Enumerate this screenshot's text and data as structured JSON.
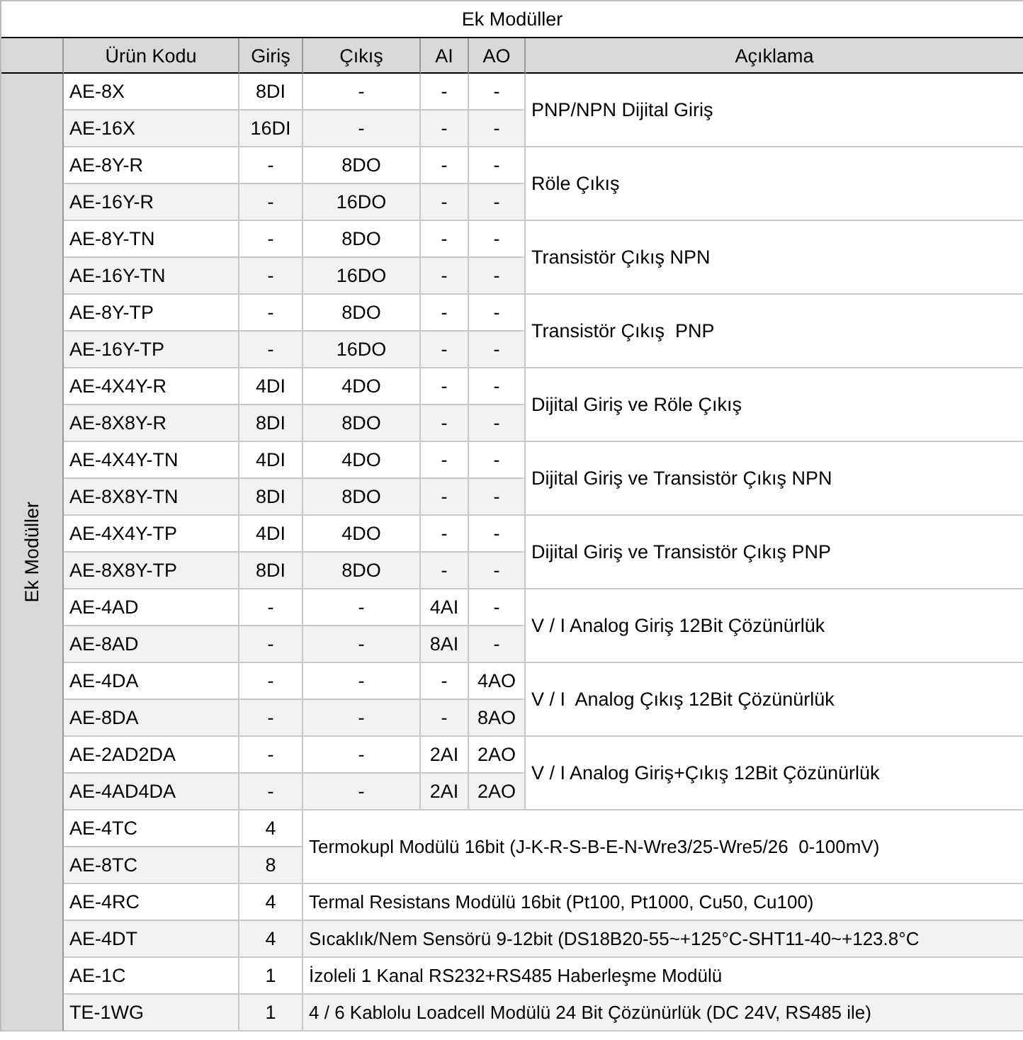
{
  "title": "Ek Modüller",
  "side_label": "Ek Modüller",
  "columns": [
    "Ürün Kodu",
    "Giriş",
    "Çıkış",
    "AI",
    "AO",
    "Açıklama"
  ],
  "groups": [
    {
      "kind": "full",
      "description": "PNP/NPN Dijital Giriş",
      "rows": [
        {
          "code": "AE-8X",
          "input": "8DI",
          "output": "-",
          "ai": "-",
          "ao": "-"
        },
        {
          "code": "AE-16X",
          "input": "16DI",
          "output": "-",
          "ai": "-",
          "ao": "-"
        }
      ]
    },
    {
      "kind": "full",
      "description": "Röle Çıkış",
      "rows": [
        {
          "code": "AE-8Y-R",
          "input": "-",
          "output": "8DO",
          "ai": "-",
          "ao": "-"
        },
        {
          "code": "AE-16Y-R",
          "input": "-",
          "output": "16DO",
          "ai": "-",
          "ao": "-"
        }
      ]
    },
    {
      "kind": "full",
      "description": "Transistör Çıkış NPN",
      "rows": [
        {
          "code": "AE-8Y-TN",
          "input": "-",
          "output": "8DO",
          "ai": "-",
          "ao": "-"
        },
        {
          "code": "AE-16Y-TN",
          "input": "-",
          "output": "16DO",
          "ai": "-",
          "ao": "-"
        }
      ]
    },
    {
      "kind": "full",
      "description": "Transistör Çıkış  PNP",
      "rows": [
        {
          "code": "AE-8Y-TP",
          "input": "-",
          "output": "8DO",
          "ai": "-",
          "ao": "-"
        },
        {
          "code": "AE-16Y-TP",
          "input": "-",
          "output": "16DO",
          "ai": "-",
          "ao": "-"
        }
      ]
    },
    {
      "kind": "full",
      "description": "Dijital Giriş ve Röle Çıkış",
      "rows": [
        {
          "code": "AE-4X4Y-R",
          "input": "4DI",
          "output": "4DO",
          "ai": "-",
          "ao": "-"
        },
        {
          "code": "AE-8X8Y-R",
          "input": "8DI",
          "output": "8DO",
          "ai": "-",
          "ao": "-"
        }
      ]
    },
    {
      "kind": "full",
      "description": "Dijital Giriş ve Transistör Çıkış NPN",
      "rows": [
        {
          "code": "AE-4X4Y-TN",
          "input": "4DI",
          "output": "4DO",
          "ai": "-",
          "ao": "-"
        },
        {
          "code": "AE-8X8Y-TN",
          "input": "8DI",
          "output": "8DO",
          "ai": "-",
          "ao": "-"
        }
      ]
    },
    {
      "kind": "full",
      "description": "Dijital Giriş ve Transistör Çıkış PNP",
      "rows": [
        {
          "code": "AE-4X4Y-TP",
          "input": "4DI",
          "output": "4DO",
          "ai": "-",
          "ao": "-"
        },
        {
          "code": "AE-8X8Y-TP",
          "input": "8DI",
          "output": "8DO",
          "ai": "-",
          "ao": "-"
        }
      ]
    },
    {
      "kind": "full",
      "description": "V / I Analog Giriş 12Bit Çözünürlük",
      "rows": [
        {
          "code": "AE-4AD",
          "input": "-",
          "output": "-",
          "ai": "4AI",
          "ao": "-"
        },
        {
          "code": "AE-8AD",
          "input": "-",
          "output": "-",
          "ai": "8AI",
          "ao": "-"
        }
      ]
    },
    {
      "kind": "full",
      "description": "V / I  Analog Çıkış 12Bit Çözünürlük",
      "rows": [
        {
          "code": "AE-4DA",
          "input": "-",
          "output": "-",
          "ai": "-",
          "ao": "4AO"
        },
        {
          "code": "AE-8DA",
          "input": "-",
          "output": "-",
          "ai": "-",
          "ao": "8AO"
        }
      ]
    },
    {
      "kind": "full",
      "description": "V / I Analog Giriş+Çıkış 12Bit Çözünürlük",
      "rows": [
        {
          "code": "AE-2AD2DA",
          "input": "-",
          "output": "-",
          "ai": "2AI",
          "ao": "2AO"
        },
        {
          "code": "AE-4AD4DA",
          "input": "-",
          "output": "-",
          "ai": "2AI",
          "ao": "2AO"
        }
      ]
    },
    {
      "kind": "wide",
      "description": "Termokupl Modülü 16bit (J-K-R-S-B-E-N-Wre3/25-Wre5/26  0-100mV)",
      "rows": [
        {
          "code": "AE-4TC",
          "input": "4"
        },
        {
          "code": "AE-8TC",
          "input": "8"
        }
      ]
    },
    {
      "kind": "wide",
      "description": "Termal Resistans Modülü 16bit (Pt100, Pt1000, Cu50, Cu100)",
      "rows": [
        {
          "code": "AE-4RC",
          "input": "4"
        }
      ]
    },
    {
      "kind": "wide",
      "description": "Sıcaklık/Nem Sensörü 9-12bit (DS18B20-55~+125°C-SHT11-40~+123.8°C",
      "rows": [
        {
          "code": "AE-4DT",
          "input": "4"
        }
      ]
    },
    {
      "kind": "wide",
      "description": "İzoleli 1 Kanal RS232+RS485 Haberleşme Modülü",
      "rows": [
        {
          "code": "AE-1C",
          "input": "1"
        }
      ]
    },
    {
      "kind": "wide",
      "description": "4 / 6 Kablolu Loadcell Modülü 24 Bit Çözünürlük (DC 24V, RS485 ile)",
      "rows": [
        {
          "code": "TE-1WG",
          "input": "1"
        }
      ]
    }
  ]
}
